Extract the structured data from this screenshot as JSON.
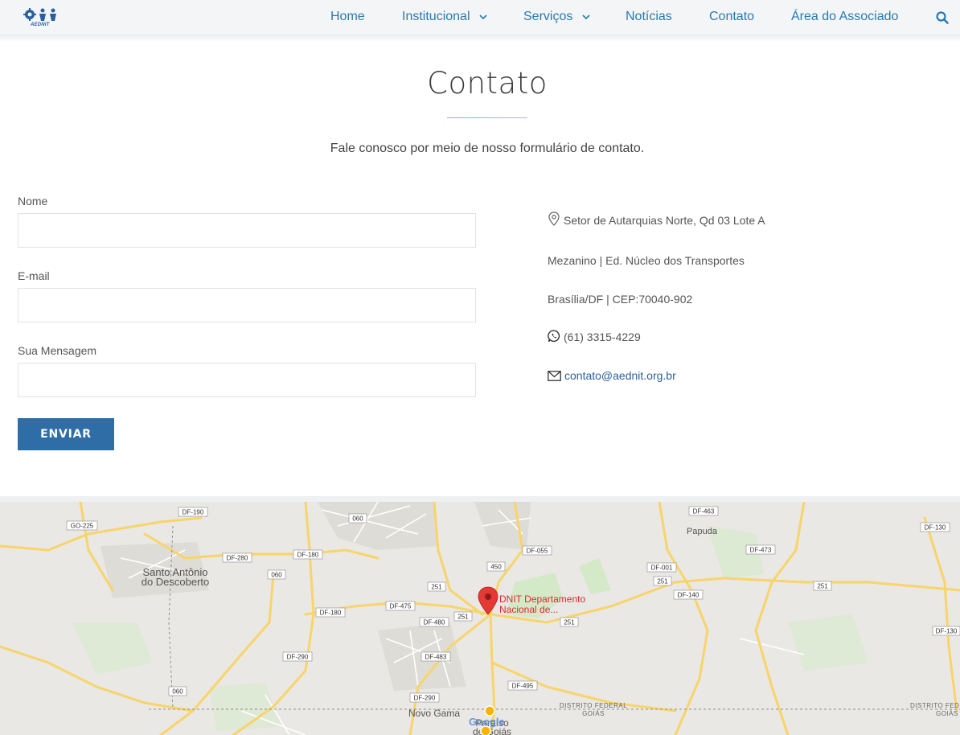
{
  "logo": {
    "text": "AEDNIT"
  },
  "nav": {
    "home": "Home",
    "institucional": "Institucional",
    "servicos": "Serviços",
    "noticias": "Notícias",
    "contato": "Contato",
    "area_associado": "Área do Associado"
  },
  "page": {
    "title": "Contato",
    "subtitle": "Fale conosco por meio de nosso formulário de contato."
  },
  "form": {
    "name_label": "Nome",
    "name_value": "",
    "email_label": "E-mail",
    "email_value": "",
    "message_label": "Sua Mensagem",
    "message_value": "",
    "submit_label": "ENVIAR"
  },
  "contact": {
    "address_line1": "Setor de Autarquias Norte, Qd 03 Lote A",
    "address_line2": "Mezanino | Ed. Núcleo dos Transportes",
    "address_line3": "Brasília/DF | CEP:70040-902",
    "phone": "(61) 3315-4229",
    "email": "contato@aednit.org.br"
  },
  "map": {
    "marker_label_1": "DNIT Departamento",
    "marker_label_2": "Nacional de...",
    "place_santo_antonio_1": "Santo Antônio",
    "place_santo_antonio_2": "do Descoberto",
    "place_papuda": "Papuda",
    "place_novo_gama": "Novo Gama",
    "place_paraiso_1": "Paraíso",
    "place_paraiso_2": "de Goiás",
    "border_df": "DISTRITO FEDERAL",
    "border_go": "GOIÁS",
    "border_df_right": "DISTRITO FEDE",
    "border_go_right": "GOIÁS",
    "google": "Google",
    "road_labels": [
      "DF-190",
      "GO-225",
      "060",
      "DF-055",
      "DF-463",
      "DF-130",
      "DF-280",
      "DF-180",
      "450",
      "DF-473",
      "060",
      "251",
      "DF-001",
      "251",
      "251",
      "DF-475",
      "DF-140",
      "DF-180",
      "DF-480",
      "251",
      "251",
      "DF-290",
      "DF-483",
      "DF-130",
      "060",
      "DF-495",
      "DF-290"
    ],
    "colors": {
      "land": "#e9e8e4",
      "park": "#cfe8c4",
      "road_major": "#f9d56b",
      "road_minor": "#ffffff",
      "marker": "#e53935"
    }
  }
}
